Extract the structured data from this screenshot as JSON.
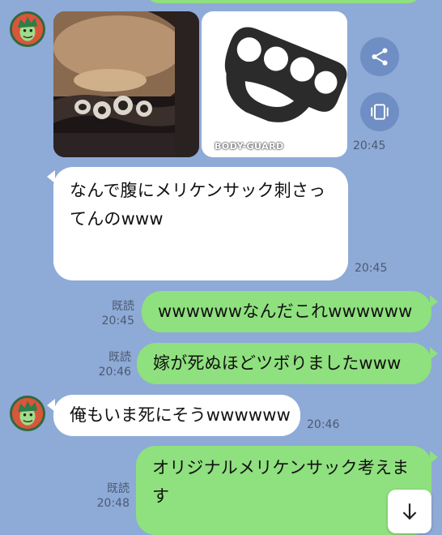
{
  "messages": [
    {
      "type": "image-pair",
      "time": "20:45",
      "watermark": "BODY-GUARD"
    },
    {
      "type": "received",
      "text": "なんで腹にメリケンサック刺さってんのwww",
      "time": "20:45"
    },
    {
      "type": "sent",
      "text": "wwwwwwなんだこれwwwwww",
      "read": "既読",
      "time": "20:45"
    },
    {
      "type": "sent",
      "text": "嫁が死ぬほどツボりましたwww",
      "read": "既読",
      "time": "20:46"
    },
    {
      "type": "received",
      "text": "俺もいま死にそうwwwwww",
      "time": "20:46"
    },
    {
      "type": "sent",
      "text": "オリジナルメリケンサック考えます",
      "read": "既読",
      "time": "20:48"
    }
  ],
  "icons": {
    "share": "share-icon",
    "capture": "capture-icon",
    "scroll_down": "arrow-down-icon"
  },
  "colors": {
    "background": "#8eaad7",
    "sent_bubble": "#8fe07e",
    "received_bubble": "#ffffff"
  }
}
